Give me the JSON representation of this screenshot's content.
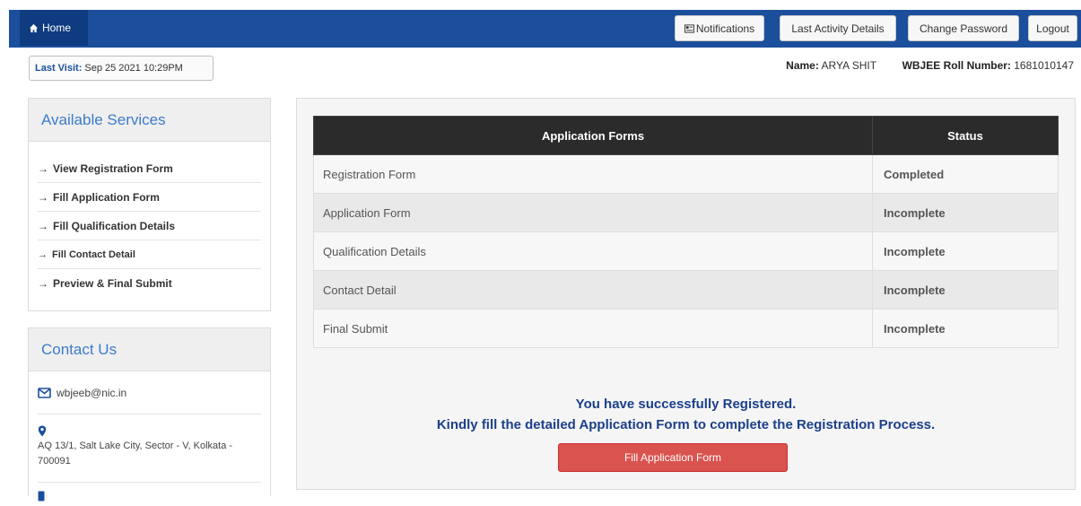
{
  "nav": {
    "home": "Home",
    "notifications": "Notifications",
    "last_activity": "Last Activity Details",
    "change_password": "Change Password",
    "logout": "Logout"
  },
  "last_visit": {
    "label": "Last Visit:",
    "value": "Sep 25 2021 10:29PM"
  },
  "user": {
    "name_label": "Name:",
    "name": "ARYA SHIT",
    "roll_label": "WBJEE Roll Number:",
    "roll": "1681010147"
  },
  "services": {
    "title": "Available Services",
    "items": [
      "View Registration Form",
      "Fill Application Form",
      "Fill Qualification Details",
      "Fill Contact Detail",
      "Preview & Final Submit"
    ]
  },
  "contact": {
    "title": "Contact Us",
    "email": "wbjeeb@nic.in",
    "address": "AQ 13/1, Salt Lake City, Sector - V, Kolkata - 700091"
  },
  "table": {
    "headers": [
      "Application Forms",
      "Status"
    ],
    "rows": [
      {
        "form": "Registration Form",
        "status": "Completed"
      },
      {
        "form": "Application Form",
        "status": "Incomplete"
      },
      {
        "form": "Qualification Details",
        "status": "Incomplete"
      },
      {
        "form": "Contact Detail",
        "status": "Incomplete"
      },
      {
        "form": "Final Submit",
        "status": "Incomplete"
      }
    ]
  },
  "message": {
    "line1": "You have successfully Registered.",
    "line2": "Kindly fill the detailed Application Form to complete the Registration Process."
  },
  "fill_button": "Fill Application Form",
  "colors": {
    "navbar": "#1b4f9c",
    "completed": "#2e7d32",
    "incomplete": "#d32f2f",
    "button": "#d9534f"
  }
}
